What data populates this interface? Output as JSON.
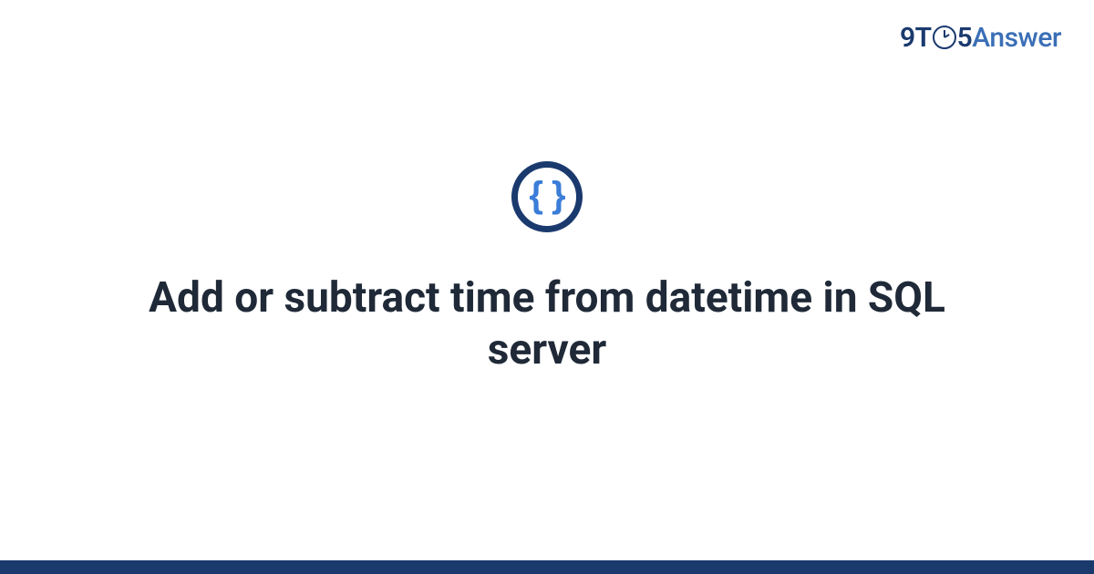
{
  "logo": {
    "part1": "9T",
    "part2": "5",
    "part3": "Answer"
  },
  "icon": {
    "glyph": "{ }",
    "name": "code-braces-icon"
  },
  "title": "Add or subtract time from datetime in SQL server",
  "colors": {
    "brand_dark": "#1a3a6e",
    "brand_light": "#3b6fb6",
    "icon_blue": "#3b7dd8",
    "text": "#1f2937"
  }
}
